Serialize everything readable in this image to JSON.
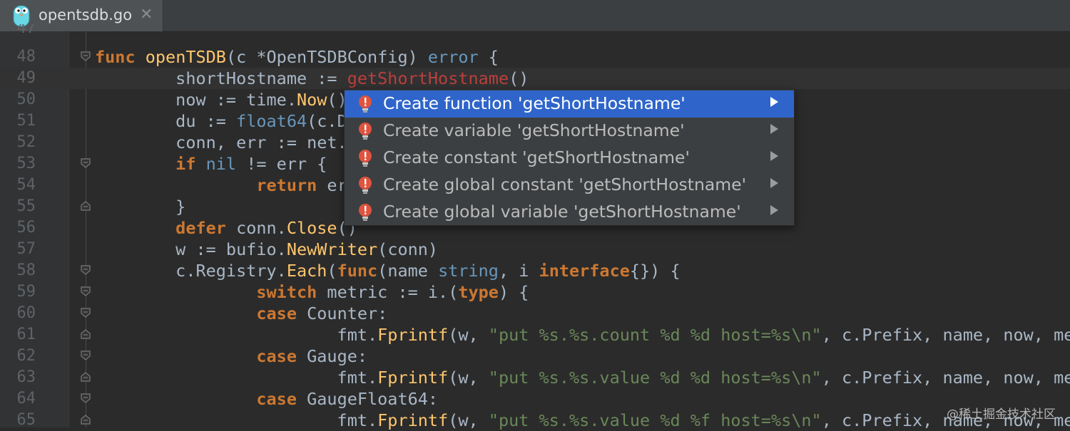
{
  "tab": {
    "title": "opentsdb.go",
    "close": "✕",
    "icon": "go-gopher-icon"
  },
  "editor": {
    "first_partial_lineno": "47",
    "lines": [
      {
        "no": "48",
        "tokens": [
          [
            "kw",
            "func "
          ],
          [
            "fn",
            "openTSDB"
          ],
          [
            "pl",
            "(c *OpenTSDBConfig) "
          ],
          [
            "ty",
            "error"
          ],
          [
            "pl",
            " {"
          ]
        ]
      },
      {
        "no": "49",
        "tokens": [
          [
            "pl",
            "        shortHostname := "
          ],
          [
            "err",
            "getShortHostname"
          ],
          [
            "pl",
            "()"
          ]
        ]
      },
      {
        "no": "50",
        "tokens": [
          [
            "pl",
            "        now := time."
          ],
          [
            "fn",
            "Now"
          ],
          [
            "pl",
            "()"
          ]
        ]
      },
      {
        "no": "51",
        "tokens": [
          [
            "pl",
            "        du := "
          ],
          [
            "ty",
            "float64"
          ],
          [
            "pl",
            "(c.D"
          ]
        ]
      },
      {
        "no": "52",
        "tokens": [
          [
            "pl",
            "        conn, err := net."
          ]
        ]
      },
      {
        "no": "53",
        "tokens": [
          [
            "kw",
            "        if "
          ],
          [
            "ty",
            "nil"
          ],
          [
            "pl",
            " != err {"
          ]
        ]
      },
      {
        "no": "54",
        "tokens": [
          [
            "kw",
            "                return "
          ],
          [
            "pl",
            "er"
          ]
        ]
      },
      {
        "no": "55",
        "tokens": [
          [
            "pl",
            "        }"
          ]
        ]
      },
      {
        "no": "56",
        "tokens": [
          [
            "kw",
            "        defer "
          ],
          [
            "pl",
            "conn."
          ],
          [
            "fn",
            "Close"
          ],
          [
            "pl",
            "()"
          ]
        ]
      },
      {
        "no": "57",
        "tokens": [
          [
            "pl",
            "        w := bufio."
          ],
          [
            "fn",
            "NewWriter"
          ],
          [
            "pl",
            "(conn)"
          ]
        ]
      },
      {
        "no": "58",
        "tokens": [
          [
            "pl",
            "        c.Registry."
          ],
          [
            "fn",
            "Each"
          ],
          [
            "pl",
            "("
          ],
          [
            "kw",
            "func"
          ],
          [
            "pl",
            "(name "
          ],
          [
            "ty",
            "string"
          ],
          [
            "pl",
            ", i "
          ],
          [
            "kw",
            "interface"
          ],
          [
            "pl",
            "{}) {"
          ]
        ]
      },
      {
        "no": "59",
        "tokens": [
          [
            "kw",
            "                switch "
          ],
          [
            "pl",
            "metric := i.("
          ],
          [
            "kw",
            "type"
          ],
          [
            "pl",
            ") {"
          ]
        ]
      },
      {
        "no": "60",
        "tokens": [
          [
            "kw",
            "                case "
          ],
          [
            "pl",
            "Counter:"
          ]
        ]
      },
      {
        "no": "61",
        "tokens": [
          [
            "pl",
            "                        fmt."
          ],
          [
            "fn",
            "Fprintf"
          ],
          [
            "pl",
            "(w, "
          ],
          [
            "str",
            "\"put %s.%s.count %d %d host=%s\\n\""
          ],
          [
            "pl",
            ", c.Prefix, name, now, met"
          ]
        ]
      },
      {
        "no": "62",
        "tokens": [
          [
            "kw",
            "                case "
          ],
          [
            "pl",
            "Gauge:"
          ]
        ]
      },
      {
        "no": "63",
        "tokens": [
          [
            "pl",
            "                        fmt."
          ],
          [
            "fn",
            "Fprintf"
          ],
          [
            "pl",
            "(w, "
          ],
          [
            "str",
            "\"put %s.%s.value %d %d host=%s\\n\""
          ],
          [
            "pl",
            ", c.Prefix, name, now, met"
          ]
        ]
      },
      {
        "no": "64",
        "tokens": [
          [
            "kw",
            "                case "
          ],
          [
            "pl",
            "GaugeFloat64:"
          ]
        ]
      },
      {
        "no": "65",
        "tokens": [
          [
            "pl",
            "                        fmt."
          ],
          [
            "fn",
            "Fprintf"
          ],
          [
            "pl",
            "(w, "
          ],
          [
            "str",
            "\"put %s.%s.value %d %f host=%s\\n\""
          ],
          [
            "pl",
            ", c.Prefix, name, now, met"
          ]
        ]
      }
    ]
  },
  "intention_popup": {
    "items": [
      {
        "label": "Create function 'getShortHostname'",
        "selected": true
      },
      {
        "label": "Create variable 'getShortHostname'",
        "selected": false
      },
      {
        "label": "Create constant 'getShortHostname'",
        "selected": false
      },
      {
        "label": "Create global constant 'getShortHostname'",
        "selected": false
      },
      {
        "label": "Create global variable 'getShortHostname'",
        "selected": false
      }
    ]
  },
  "watermark": "@稀土掘金技术社区",
  "colors": {
    "background": "#2b2b2b",
    "keyword": "#cc7832",
    "function": "#ffc66d",
    "type": "#6897bb",
    "string": "#6a8759",
    "error": "#bc3f3c",
    "selection": "#2f65ca"
  }
}
